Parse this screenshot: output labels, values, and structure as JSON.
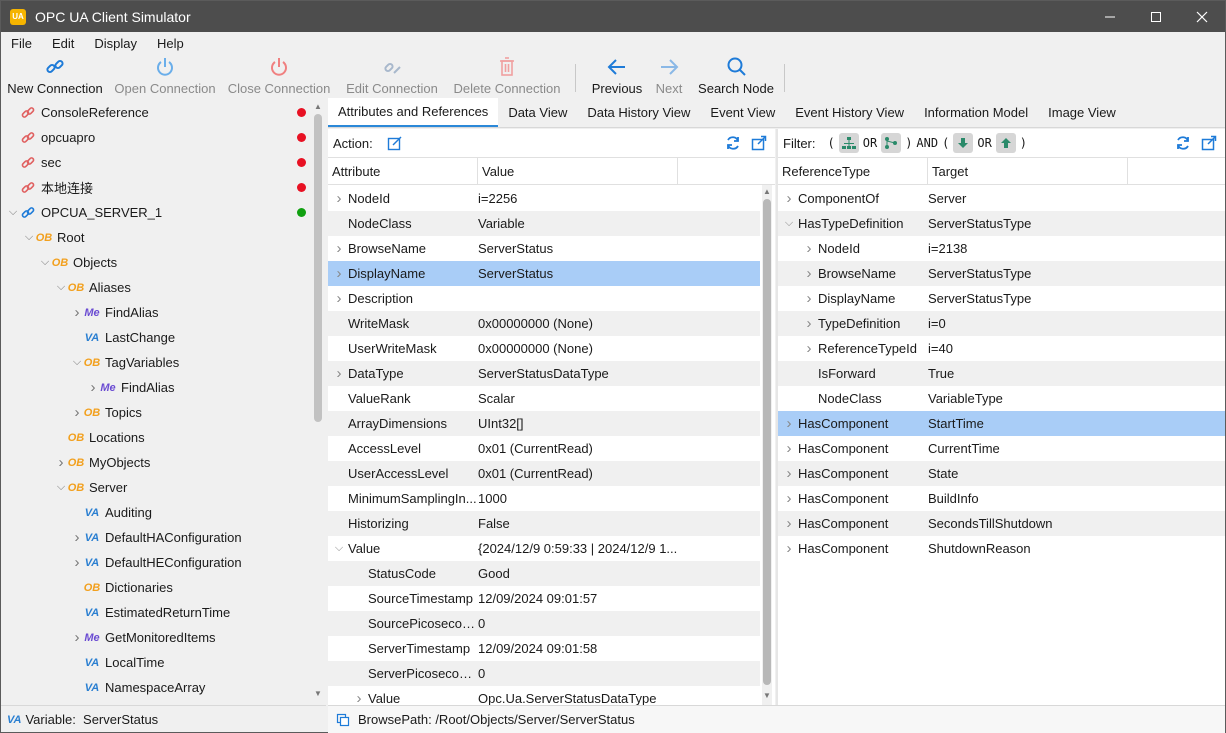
{
  "window": {
    "title": "OPC UA Client Simulator",
    "app_icon_text": "UA"
  },
  "menu": [
    "File",
    "Edit",
    "Display",
    "Help"
  ],
  "toolbar": {
    "new_connection": "New Connection",
    "open_connection": "Open Connection",
    "close_connection": "Close Connection",
    "edit_connection": "Edit Connection",
    "delete_connection": "Delete Connection",
    "previous": "Previous",
    "next": "Next",
    "search_node": "Search Node"
  },
  "tree": [
    {
      "label": "ConsoleReference",
      "icon": "connection-icon",
      "depth": 0,
      "exp": "",
      "status": "red"
    },
    {
      "label": "opcuapro",
      "icon": "connection-icon",
      "depth": 0,
      "exp": "",
      "status": "red"
    },
    {
      "label": "sec",
      "icon": "connection-icon",
      "depth": 0,
      "exp": "",
      "status": "red"
    },
    {
      "label": "本地连接",
      "icon": "connection-icon",
      "depth": 0,
      "exp": "",
      "status": "red"
    },
    {
      "label": "OPCUA_SERVER_1",
      "icon": "connection-icon",
      "depth": 0,
      "exp": "open",
      "status": "green"
    },
    {
      "label": "Root",
      "icon": "OB",
      "depth": 1,
      "exp": "open"
    },
    {
      "label": "Objects",
      "icon": "OB",
      "depth": 2,
      "exp": "open"
    },
    {
      "label": "Aliases",
      "icon": "OB",
      "depth": 3,
      "exp": "open"
    },
    {
      "label": "FindAlias",
      "icon": "Me",
      "depth": 4,
      "exp": "closed"
    },
    {
      "label": "LastChange",
      "icon": "VA",
      "depth": 4,
      "exp": ""
    },
    {
      "label": "TagVariables",
      "icon": "OB",
      "depth": 4,
      "exp": "open"
    },
    {
      "label": "FindAlias",
      "icon": "Me",
      "depth": 5,
      "exp": "closed"
    },
    {
      "label": "Topics",
      "icon": "OB",
      "depth": 4,
      "exp": "closed"
    },
    {
      "label": "Locations",
      "icon": "OB",
      "depth": 3,
      "exp": ""
    },
    {
      "label": "MyObjects",
      "icon": "OB",
      "depth": 3,
      "exp": "closed"
    },
    {
      "label": "Server",
      "icon": "OB",
      "depth": 3,
      "exp": "open"
    },
    {
      "label": "Auditing",
      "icon": "VA",
      "depth": 4,
      "exp": ""
    },
    {
      "label": "DefaultHAConfiguration",
      "icon": "VA",
      "depth": 4,
      "exp": "closed"
    },
    {
      "label": "DefaultHEConfiguration",
      "icon": "VA",
      "depth": 4,
      "exp": "closed"
    },
    {
      "label": "Dictionaries",
      "icon": "OB",
      "depth": 4,
      "exp": ""
    },
    {
      "label": "EstimatedReturnTime",
      "icon": "VA",
      "depth": 4,
      "exp": ""
    },
    {
      "label": "GetMonitoredItems",
      "icon": "Me",
      "depth": 4,
      "exp": "closed"
    },
    {
      "label": "LocalTime",
      "icon": "VA",
      "depth": 4,
      "exp": ""
    },
    {
      "label": "NamespaceArray",
      "icon": "VA",
      "depth": 4,
      "exp": ""
    }
  ],
  "status_left": {
    "icon": "VA",
    "text": "Variable:  ServerStatus"
  },
  "tabs": [
    "Attributes and References",
    "Data View",
    "Data History View",
    "Event View",
    "Event History View",
    "Information Model",
    "Image View"
  ],
  "attributes": {
    "action_label": "Action:",
    "col_attribute": "Attribute",
    "col_value": "Value",
    "rows": [
      {
        "name": "NodeId",
        "value": "i=2256",
        "exp": "closed",
        "indent": 0
      },
      {
        "name": "NodeClass",
        "value": "Variable",
        "exp": "",
        "indent": 0
      },
      {
        "name": "BrowseName",
        "value": "ServerStatus",
        "exp": "closed",
        "indent": 0
      },
      {
        "name": "DisplayName",
        "value": "ServerStatus",
        "exp": "closed",
        "indent": 0,
        "selected": true
      },
      {
        "name": "Description",
        "value": "",
        "exp": "closed",
        "indent": 0
      },
      {
        "name": "WriteMask",
        "value": "0x00000000 (None)",
        "exp": "",
        "indent": 0
      },
      {
        "name": "UserWriteMask",
        "value": "0x00000000 (None)",
        "exp": "",
        "indent": 0
      },
      {
        "name": "DataType",
        "value": "ServerStatusDataType",
        "exp": "closed",
        "indent": 0
      },
      {
        "name": "ValueRank",
        "value": "Scalar",
        "exp": "",
        "indent": 0
      },
      {
        "name": "ArrayDimensions",
        "value": "UInt32[]",
        "exp": "",
        "indent": 0
      },
      {
        "name": "AccessLevel",
        "value": "0x01 (CurrentRead)",
        "exp": "",
        "indent": 0
      },
      {
        "name": "UserAccessLevel",
        "value": "0x01 (CurrentRead)",
        "exp": "",
        "indent": 0
      },
      {
        "name": "MinimumSamplingIn...",
        "value": "1000",
        "exp": "",
        "indent": 0
      },
      {
        "name": "Historizing",
        "value": "False",
        "exp": "",
        "indent": 0
      },
      {
        "name": "Value",
        "value": "{2024/12/9 0:59:33 | 2024/12/9 1...",
        "exp": "open",
        "indent": 0
      },
      {
        "name": "StatusCode",
        "value": "Good",
        "exp": "",
        "indent": 1
      },
      {
        "name": "SourceTimestamp",
        "value": "12/09/2024 09:01:57",
        "exp": "",
        "indent": 1
      },
      {
        "name": "SourcePicosecon...",
        "value": "0",
        "exp": "",
        "indent": 1
      },
      {
        "name": "ServerTimestamp",
        "value": "12/09/2024 09:01:58",
        "exp": "",
        "indent": 1
      },
      {
        "name": "ServerPicoseconds",
        "value": "0",
        "exp": "",
        "indent": 1
      },
      {
        "name": "Value",
        "value": "Opc.Ua.ServerStatusDataType",
        "exp": "closed",
        "indent": 1
      }
    ]
  },
  "references": {
    "filter_label": "Filter:",
    "filter_or1": "OR",
    "filter_and": "AND",
    "filter_or2": "OR",
    "col_type": "ReferenceType",
    "col_target": "Target",
    "rows": [
      {
        "type": "ComponentOf",
        "target": "Server",
        "exp": "closed",
        "indent": 0
      },
      {
        "type": "HasTypeDefinition",
        "target": "ServerStatusType",
        "exp": "open",
        "indent": 0
      },
      {
        "type": "NodeId",
        "target": "i=2138",
        "exp": "closed",
        "indent": 1
      },
      {
        "type": "BrowseName",
        "target": "ServerStatusType",
        "exp": "closed",
        "indent": 1
      },
      {
        "type": "DisplayName",
        "target": "ServerStatusType",
        "exp": "closed",
        "indent": 1
      },
      {
        "type": "TypeDefinition",
        "target": "i=0",
        "exp": "closed",
        "indent": 1
      },
      {
        "type": "ReferenceTypeId",
        "target": "i=40",
        "exp": "closed",
        "indent": 1
      },
      {
        "type": "IsForward",
        "target": "True",
        "exp": "",
        "indent": 1
      },
      {
        "type": "NodeClass",
        "target": "VariableType",
        "exp": "",
        "indent": 1
      },
      {
        "type": "HasComponent",
        "target": "StartTime",
        "exp": "closed",
        "indent": 0,
        "selected": true
      },
      {
        "type": "HasComponent",
        "target": "CurrentTime",
        "exp": "closed",
        "indent": 0
      },
      {
        "type": "HasComponent",
        "target": "State",
        "exp": "closed",
        "indent": 0
      },
      {
        "type": "HasComponent",
        "target": "BuildInfo",
        "exp": "closed",
        "indent": 0
      },
      {
        "type": "HasComponent",
        "target": "SecondsTillShutdown",
        "exp": "closed",
        "indent": 0
      },
      {
        "type": "HasComponent",
        "target": "ShutdownReason",
        "exp": "closed",
        "indent": 0
      }
    ]
  },
  "status_right": {
    "text": "BrowsePath: /Root/Objects/Server/ServerStatus"
  },
  "colors": {
    "accent": "#2b88d8",
    "selected_row": "#a9cdf7",
    "status_red": "#e81123",
    "status_green": "#10a010",
    "titlebar": "#4d4d4d"
  }
}
